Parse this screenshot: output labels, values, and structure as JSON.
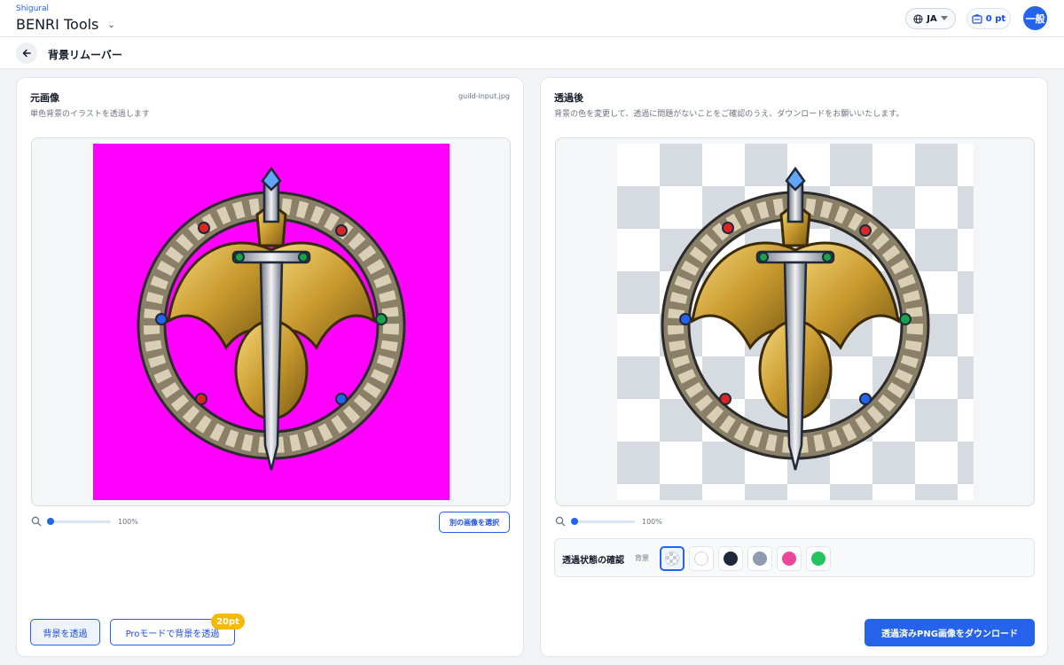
{
  "header": {
    "brand_small": "Shigural",
    "brand_name": "BENRI Tools",
    "lang": "JA",
    "points": "0 pt",
    "avatar": "一般"
  },
  "subheader": {
    "title": "背景リムーバー"
  },
  "left_panel": {
    "title": "元画像",
    "subtitle": "単色背景のイラストを透過します",
    "filename": "guild-input.jpg",
    "zoom": "100%",
    "zoom_level": 0.0,
    "select_label": "別の画像を選択",
    "remove_label": "背景を透過",
    "pro_label": "Proモードで背景を透過",
    "pro_cost": "20pt",
    "bg_color": "#ff00ff"
  },
  "right_panel": {
    "title": "透過後",
    "subtitle": "背景の色を変更して、透過に問題がないことをご確認のうえ、ダウンロードをお願いいたします。",
    "zoom": "100%",
    "zoom_level": 0.0,
    "check_label": "透過状態の確認",
    "bg_label": "背景",
    "swatches": [
      {
        "name": "transparent",
        "color": "checker",
        "selected": true
      },
      {
        "name": "white",
        "color": "#ffffff",
        "selected": false
      },
      {
        "name": "dark",
        "color": "#1e293b",
        "selected": false
      },
      {
        "name": "gray",
        "color": "#8f9bb0",
        "selected": false
      },
      {
        "name": "pink",
        "color": "#ec4899",
        "selected": false
      },
      {
        "name": "green",
        "color": "#22c55e",
        "selected": false
      }
    ],
    "download_label": "透過済みPNG画像をダウンロード"
  },
  "accent": "#2563eb",
  "icons": [
    "globe-icon",
    "caret-down-icon",
    "wallet-icon",
    "back-arrow-icon",
    "search-icon",
    "chevron-down-icon"
  ]
}
